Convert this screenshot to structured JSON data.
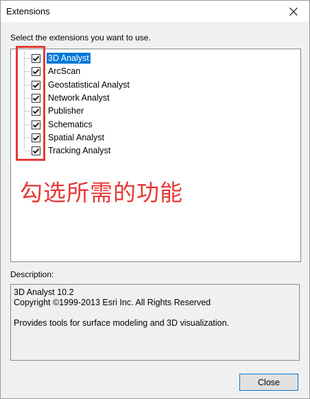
{
  "window": {
    "title": "Extensions"
  },
  "prompt": "Select the extensions you want to use.",
  "extensions": [
    {
      "label": "3D Analyst",
      "checked": true,
      "selected": true
    },
    {
      "label": "ArcScan",
      "checked": true,
      "selected": false
    },
    {
      "label": "Geostatistical Analyst",
      "checked": true,
      "selected": false
    },
    {
      "label": "Network Analyst",
      "checked": true,
      "selected": false
    },
    {
      "label": "Publisher",
      "checked": true,
      "selected": false
    },
    {
      "label": "Schematics",
      "checked": true,
      "selected": false
    },
    {
      "label": "Spatial Analyst",
      "checked": true,
      "selected": false
    },
    {
      "label": "Tracking Analyst",
      "checked": true,
      "selected": false
    }
  ],
  "annotation": "勾选所需的功能",
  "description": {
    "label": "Description:",
    "line1": "3D Analyst 10.2",
    "line2": "Copyright ©1999-2013 Esri Inc. All Rights Reserved",
    "line3": "Provides tools for surface modeling and 3D visualization."
  },
  "buttons": {
    "close_label": "Close"
  },
  "colors": {
    "selection": "#0078d7",
    "annotation": "#e53935"
  }
}
